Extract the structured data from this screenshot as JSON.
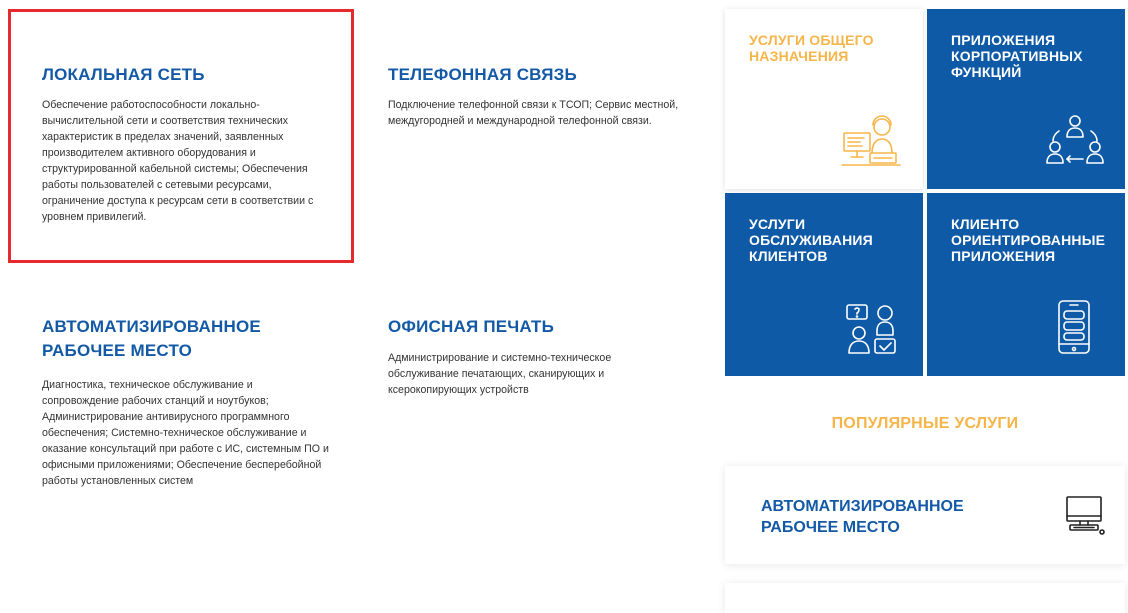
{
  "services": [
    {
      "title": "ЛОКАЛЬНАЯ СЕТЬ",
      "desc": "Обеспечение работоспособности локально-вычислительной сети и соответствия технических характеристик в пределах значений, заявленных производителем активного оборудования и структурированной кабельной системы; Обеспечения работы пользователей с сетевыми ресурсами, ограничение доступа к ресурсам сети в соответствии с уровнем привилегий."
    },
    {
      "title": "ТЕЛЕФОННАЯ СВЯЗЬ",
      "desc": "Подключение телефонной связи к ТСОП; Сервис местной, междугородней и международной телефонной связи."
    },
    {
      "title": "АВТОМАТИЗИРОВАННОЕ РАБОЧЕЕ МЕСТО",
      "desc": "Диагностика, техническое обслуживание и сопровождение рабочих станций и ноутбуков; Администрирование антивирусного программного обеспечения; Системно-техническое обслуживание и оказание консультаций при работе с ИС, системным ПО и офисными приложениями; Обеспечение бесперебойной работы установленных систем"
    },
    {
      "title": "ОФИСНАЯ ПЕЧАТЬ",
      "desc": "Администрирование и системно-техническое обслуживание печатающих, сканирующих и ксерокопирующих устройств"
    }
  ],
  "tiles": [
    {
      "title": "УСЛУГИ ОБЩЕГО\nНАЗНАЧЕНИЯ",
      "icon": "support-operator-icon",
      "style": "white"
    },
    {
      "title": "ПРИЛОЖЕНИЯ\nКОРПОРАТИВНЫХ\nФУНКЦИЙ",
      "icon": "users-exchange-icon",
      "style": "blue"
    },
    {
      "title": "УСЛУГИ\nОБСЛУЖИВАНИЯ\nКЛИЕНТОВ",
      "icon": "client-support-icon",
      "style": "blue"
    },
    {
      "title": "КЛИЕНТО\nОРИЕНТИРОВАННЫЕ\nПРИЛОЖЕНИЯ",
      "icon": "mobile-chat-icon",
      "style": "blue"
    }
  ],
  "popular": {
    "heading": "ПОПУЛЯРНЫЕ УСЛУГИ",
    "items": [
      {
        "title": "АВТОМАТИЗИРОВАННОЕ РАБОЧЕЕ МЕСТО",
        "icon": "computer-monitor-icon"
      }
    ]
  },
  "colors": {
    "accent_blue": "#0e5aa7",
    "title_blue": "#1359a6",
    "accent_orange": "#f6b548",
    "highlight_red": "#e42a2e"
  }
}
